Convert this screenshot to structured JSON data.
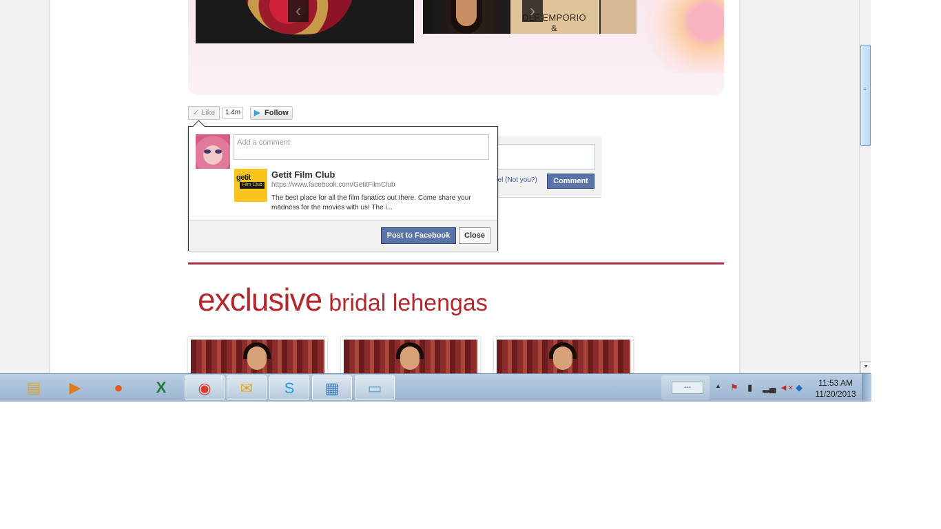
{
  "banner": {
    "slide_text": "DLF EMPORIO\n&",
    "prev_icon": "chevron-left-icon",
    "next_icon": "chevron-right-icon"
  },
  "social": {
    "like_label": "Like",
    "like_count": "1.4m",
    "follow_label": "Follow"
  },
  "bg_comment": {
    "not_you_text": "bel (Not you?)",
    "comment_button": "Comment"
  },
  "popup": {
    "comment_placeholder": "Add a comment",
    "page_logo_line1": "getit",
    "page_logo_line2": "Film Club",
    "page_title": "Getit Film Club",
    "page_url": "https://www.facebook.com/GetitFilmClub",
    "page_description": "The best place for all the film fanatics out there. Come share your madness for the movies with us! The i...",
    "post_button": "Post to Facebook",
    "close_button": "Close"
  },
  "section": {
    "title_big": "exclusive",
    "title_small": "bridal lehengas"
  },
  "taskbar": {
    "apps": [
      "ie-icon",
      "file-explorer-icon",
      "media-player-icon",
      "firefox-icon",
      "excel-icon",
      "chrome-icon",
      "outlook-icon",
      "skype-icon",
      "photo-viewer-icon",
      "notepad-icon"
    ],
    "tray_text": "---",
    "time": "11:53 AM",
    "date": "11/20/2013"
  },
  "colors": {
    "accent_red": "#b3282d",
    "facebook_blue": "#5b74a8",
    "divider": "#a82d45"
  }
}
